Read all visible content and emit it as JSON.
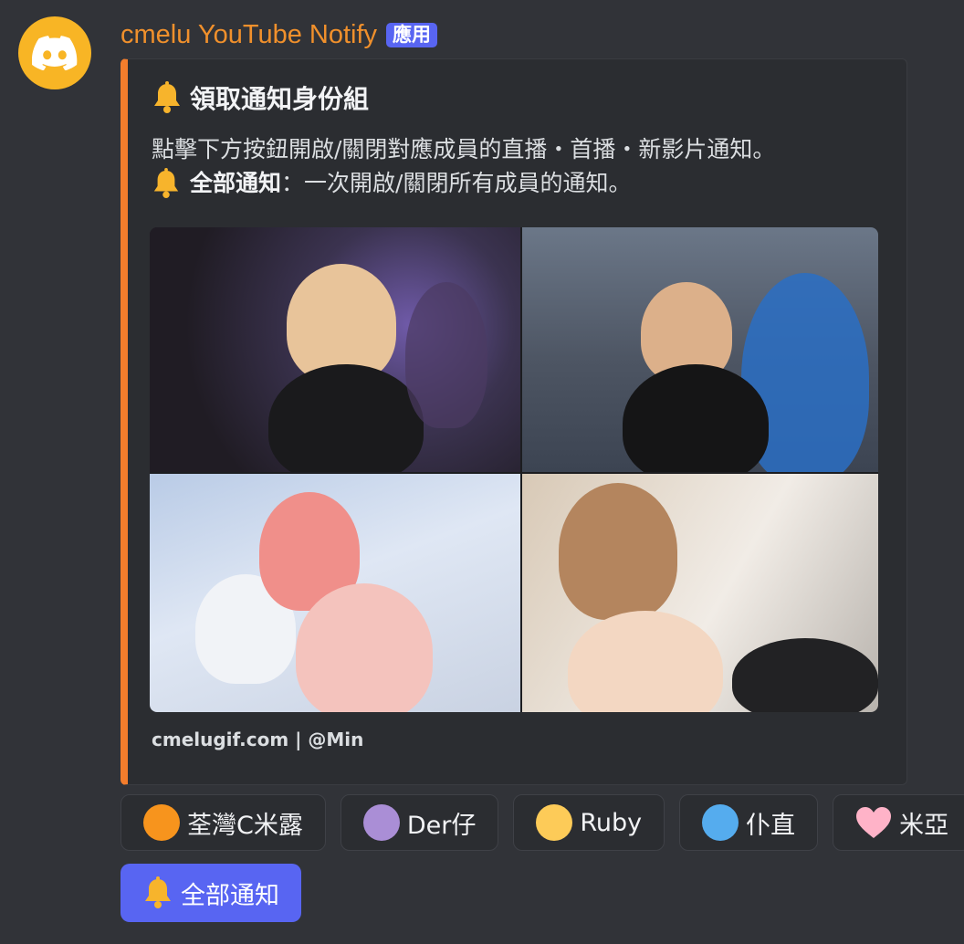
{
  "message": {
    "author": "cmelu YouTube Notify",
    "badge": "應用",
    "avatar_icon": "discord-logo-icon",
    "avatar_color": "#f8b525",
    "author_color": "#f0902c"
  },
  "embed": {
    "accent_color": "#f37d2c",
    "title_icon": "bell-icon",
    "title": "領取通知身份組",
    "description_line1": "點擊下方按鈕開啟/關閉對應成員的直播・首播・新影片通知。",
    "description_line2_bold": "全部通知",
    "description_line2_rest": "：一次開啟/關閉所有成員的通知。",
    "image_panels": [
      "photo-top-left",
      "photo-top-right",
      "photo-bottom-left",
      "photo-bottom-right"
    ],
    "footer": "cmelugif.com | @Min"
  },
  "buttons": [
    {
      "label": "荃灣C米露",
      "icon": "orange-circle-icon",
      "color": "#f7941d"
    },
    {
      "label": "Der仔",
      "icon": "purple-circle-icon",
      "color": "#aa8ed6"
    },
    {
      "label": "Ruby",
      "icon": "yellow-circle-icon",
      "color": "#fdcb58"
    },
    {
      "label": "仆直",
      "icon": "blue-circle-icon",
      "color": "#55acee"
    },
    {
      "label": "米亞",
      "icon": "pink-heart-icon",
      "color": "#ffb3c8"
    }
  ],
  "all_button": {
    "label": "全部通知",
    "icon": "bell-icon",
    "color": "#5865f2"
  }
}
